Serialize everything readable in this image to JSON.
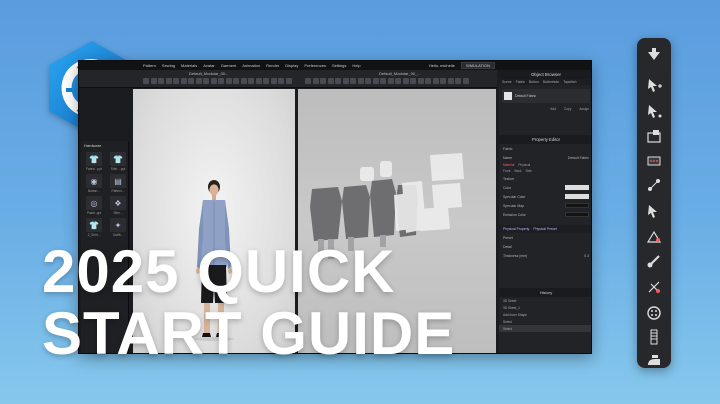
{
  "brand": {
    "logo_icon": "clo-logo-icon",
    "accent": "#1e8bd6"
  },
  "headline": {
    "line1": "2025 QUICK",
    "line2": "START GUIDE"
  },
  "app": {
    "menu": [
      "Pattern",
      "Sewing",
      "Materials",
      "Avatar",
      "Garment",
      "Animation",
      "Render",
      "Display",
      "Preferences",
      "Settings",
      "Help"
    ],
    "user": "Hello, michelle",
    "simulation_button": "SIMULATION",
    "left_tab_title": "Default_Modular_00...",
    "center_tab_title": "Default_Modular_00_...",
    "library": {
      "title": "Hardware",
      "items": [
        {
          "label": "Fabric...ppt",
          "icon": "shirt-icon"
        },
        {
          "label": "Shirt ...ppt",
          "icon": "shirt-icon"
        },
        {
          "label": "Button...",
          "icon": "button-icon"
        },
        {
          "label": "Pattern...",
          "icon": "pattern-icon"
        },
        {
          "label": "Patch..ppt",
          "icon": "patch-icon"
        },
        {
          "label": "Slee...",
          "icon": "sleeve-icon"
        },
        {
          "label": "2_Shirt...",
          "icon": "shirt-icon"
        },
        {
          "label": "Outfit...",
          "icon": "outfit-icon"
        }
      ]
    },
    "right_panel": {
      "title": "Object Browser",
      "tabs": [
        "Scene",
        "Fabric",
        "Button",
        "Buttonhole",
        "Topstitch"
      ],
      "object_label": "Default Fabric",
      "object_actions": [
        "Add",
        "Copy",
        "Assign"
      ],
      "property_title": "Property Editor",
      "fields": [
        {
          "label": "Fabric",
          "value": ""
        },
        {
          "label": "Name",
          "value": "Default Fabric"
        }
      ],
      "material_tabs": [
        "Material",
        "Physical"
      ],
      "material_subtabs": [
        "Front",
        "Back",
        "Side"
      ],
      "material_rows": [
        {
          "label": "Texture",
          "swatch": "none"
        },
        {
          "label": "Color",
          "swatch": "light"
        },
        {
          "label": "Specular Color",
          "swatch": "light"
        },
        {
          "label": "Specular Map",
          "swatch": "dark"
        },
        {
          "label": "Emission Color",
          "swatch": "dark"
        }
      ],
      "physical_tabs": [
        "Physical Property",
        "Physical Preset"
      ],
      "physical_rows": [
        {
          "label": "Preset",
          "value": ""
        },
        {
          "label": "Detail",
          "value": ""
        },
        {
          "label": "Thickness (mm)",
          "value": "0.3"
        }
      ],
      "history_title": "History",
      "history_rows": [
        "3D Sheet",
        "3D Sheet_1",
        "Add Inner Shape",
        "Select",
        "Select"
      ]
    }
  },
  "palette": {
    "icons": [
      "arrow-down-icon",
      "move-icon",
      "pen-icon",
      "transform-icon",
      "sewing-icon",
      "segment-sewing-icon",
      "pin-icon",
      "fold-icon",
      "brush-icon",
      "needle-icon",
      "button-icon",
      "zipper-icon",
      "iron-icon"
    ]
  }
}
